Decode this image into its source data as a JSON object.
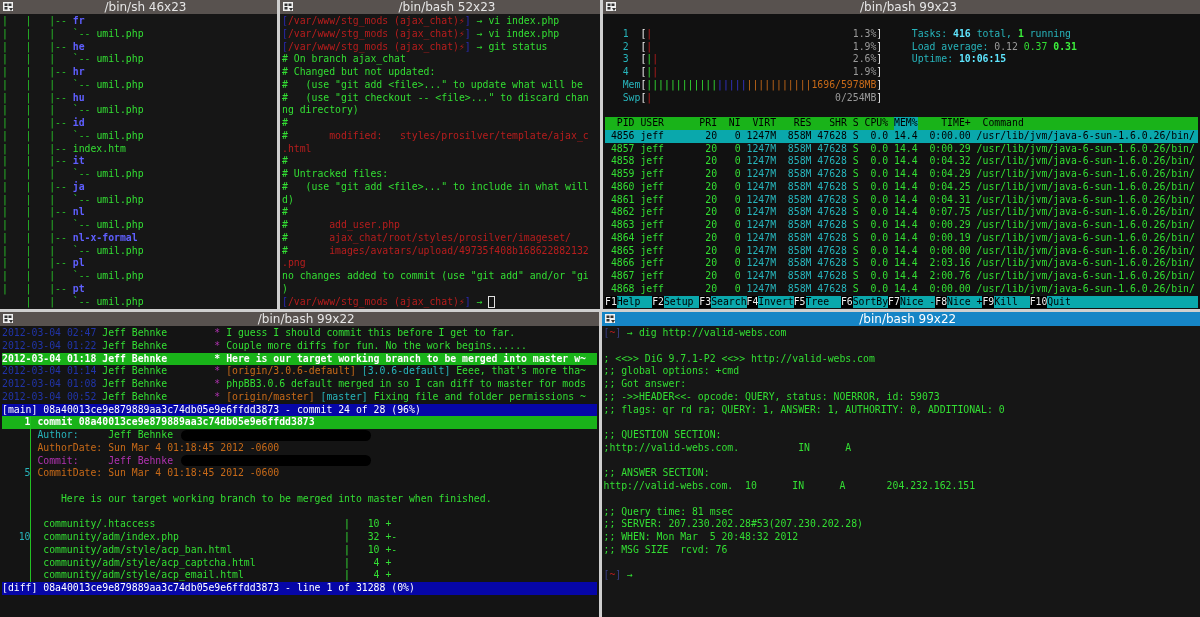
{
  "rows": [
    {
      "panes": [
        {
          "title": "/bin/sh 46x23",
          "active": false,
          "kind": "shell",
          "lines": [
            {
              "spans": [
                {
                  "text": "|   |   |-- ",
                  "kind": "pipe"
                },
                {
                  "text": "fr",
                  "kind": "dir"
                }
              ]
            },
            {
              "spans": [
                {
                  "text": "|   |   |   `-- ",
                  "kind": "pipe"
                },
                {
                  "text": "umil.php",
                  "kind": "g"
                }
              ]
            },
            {
              "spans": [
                {
                  "text": "|   |   |-- ",
                  "kind": "pipe"
                },
                {
                  "text": "he",
                  "kind": "dir"
                }
              ]
            },
            {
              "spans": [
                {
                  "text": "|   |   |   `-- ",
                  "kind": "pipe"
                },
                {
                  "text": "umil.php",
                  "kind": "g"
                }
              ]
            },
            {
              "spans": [
                {
                  "text": "|   |   |-- ",
                  "kind": "pipe"
                },
                {
                  "text": "hr",
                  "kind": "dir"
                }
              ]
            },
            {
              "spans": [
                {
                  "text": "|   |   |   `-- ",
                  "kind": "pipe"
                },
                {
                  "text": "umil.php",
                  "kind": "g"
                }
              ]
            },
            {
              "spans": [
                {
                  "text": "|   |   |-- ",
                  "kind": "pipe"
                },
                {
                  "text": "hu",
                  "kind": "dir"
                }
              ]
            },
            {
              "spans": [
                {
                  "text": "|   |   |   `-- ",
                  "kind": "pipe"
                },
                {
                  "text": "umil.php",
                  "kind": "g"
                }
              ]
            },
            {
              "spans": [
                {
                  "text": "|   |   |-- ",
                  "kind": "pipe"
                },
                {
                  "text": "id",
                  "kind": "dir"
                }
              ]
            },
            {
              "spans": [
                {
                  "text": "|   |   |   `-- ",
                  "kind": "pipe"
                },
                {
                  "text": "umil.php",
                  "kind": "g"
                }
              ]
            },
            {
              "spans": [
                {
                  "text": "|   |   |-- ",
                  "kind": "pipe"
                },
                {
                  "text": "index.htm",
                  "kind": "g"
                }
              ]
            },
            {
              "spans": [
                {
                  "text": "|   |   |-- ",
                  "kind": "pipe"
                },
                {
                  "text": "it",
                  "kind": "dir"
                }
              ]
            },
            {
              "spans": [
                {
                  "text": "|   |   |   `-- ",
                  "kind": "pipe"
                },
                {
                  "text": "umil.php",
                  "kind": "g"
                }
              ]
            },
            {
              "spans": [
                {
                  "text": "|   |   |-- ",
                  "kind": "pipe"
                },
                {
                  "text": "ja",
                  "kind": "dir"
                }
              ]
            },
            {
              "spans": [
                {
                  "text": "|   |   |   `-- ",
                  "kind": "pipe"
                },
                {
                  "text": "umil.php",
                  "kind": "g"
                }
              ]
            },
            {
              "spans": [
                {
                  "text": "|   |   |-- ",
                  "kind": "pipe"
                },
                {
                  "text": "nl",
                  "kind": "dir"
                }
              ]
            },
            {
              "spans": [
                {
                  "text": "|   |   |   `-- ",
                  "kind": "pipe"
                },
                {
                  "text": "umil.php",
                  "kind": "g"
                }
              ]
            },
            {
              "spans": [
                {
                  "text": "|   |   |-- ",
                  "kind": "pipe"
                },
                {
                  "text": "nl-x-formal",
                  "kind": "dir"
                }
              ]
            },
            {
              "spans": [
                {
                  "text": "|   |   |   `-- ",
                  "kind": "pipe"
                },
                {
                  "text": "umil.php",
                  "kind": "g"
                }
              ]
            },
            {
              "spans": [
                {
                  "text": "|   |   |-- ",
                  "kind": "pipe"
                },
                {
                  "text": "pl",
                  "kind": "dir"
                }
              ]
            },
            {
              "spans": [
                {
                  "text": "|   |   |   `-- ",
                  "kind": "pipe"
                },
                {
                  "text": "umil.php",
                  "kind": "g"
                }
              ]
            },
            {
              "spans": [
                {
                  "text": "|   |   |-- ",
                  "kind": "pipe"
                },
                {
                  "text": "pt",
                  "kind": "dir"
                }
              ]
            },
            {
              "spans": [
                {
                  "text": "    |   |   `-- ",
                  "kind": "pipe"
                },
                {
                  "text": "umil.php",
                  "kind": "g"
                }
              ]
            }
          ]
        },
        {
          "title": "/bin/bash 52x23",
          "active": false,
          "kind": "shell",
          "lines": [
            {
              "spans": [
                {
                  "text": "[",
                  "kind": "bracket"
                },
                {
                  "text": "/var/www/stg_mods (ajax_chat)⚡",
                  "kind": "red"
                },
                {
                  "text": "]",
                  "kind": "bracket"
                },
                {
                  "text": " → vi index.php",
                  "kind": "g"
                }
              ]
            },
            {
              "spans": [
                {
                  "text": "[",
                  "kind": "bracket"
                },
                {
                  "text": "/var/www/stg_mods (ajax_chat)⚡",
                  "kind": "red"
                },
                {
                  "text": "]",
                  "kind": "bracket"
                },
                {
                  "text": " → vi index.php",
                  "kind": "g"
                }
              ]
            },
            {
              "spans": [
                {
                  "text": "[",
                  "kind": "bracket"
                },
                {
                  "text": "/var/www/stg_mods (ajax_chat)⚡",
                  "kind": "red"
                },
                {
                  "text": "]",
                  "kind": "bracket"
                },
                {
                  "text": " → git status",
                  "kind": "g"
                }
              ]
            },
            {
              "spans": [
                {
                  "text": "# On branch ajax_chat",
                  "kind": "g"
                }
              ]
            },
            {
              "spans": [
                {
                  "text": "# Changed but not updated:",
                  "kind": "g"
                }
              ]
            },
            {
              "spans": [
                {
                  "text": "#   (use \"git add <file>...\" to update what will be",
                  "kind": "g"
                }
              ]
            },
            {
              "spans": [
                {
                  "text": "#   (use \"git checkout -- <file>...\" to discard chan",
                  "kind": "g"
                }
              ]
            },
            {
              "spans": [
                {
                  "text": "ng directory)",
                  "kind": "g"
                }
              ]
            },
            {
              "spans": [
                {
                  "text": "#",
                  "kind": "g"
                }
              ]
            },
            {
              "spans": [
                {
                  "text": "#",
                  "kind": "g"
                },
                {
                  "text": "       modified:   styles/prosilver/template/ajax_c",
                  "kind": "red"
                }
              ]
            },
            {
              "spans": [
                {
                  "text": ".html",
                  "kind": "red"
                }
              ]
            },
            {
              "spans": [
                {
                  "text": "#",
                  "kind": "g"
                }
              ]
            },
            {
              "spans": [
                {
                  "text": "# Untracked files:",
                  "kind": "g"
                }
              ]
            },
            {
              "spans": [
                {
                  "text": "#   (use \"git add <file>...\" to include in what will",
                  "kind": "g"
                }
              ]
            },
            {
              "spans": [
                {
                  "text": "d)",
                  "kind": "g"
                }
              ]
            },
            {
              "spans": [
                {
                  "text": "#",
                  "kind": "g"
                }
              ]
            },
            {
              "spans": [
                {
                  "text": "#",
                  "kind": "g"
                },
                {
                  "text": "       add_user.php",
                  "kind": "red"
                }
              ]
            },
            {
              "spans": [
                {
                  "text": "#",
                  "kind": "g"
                },
                {
                  "text": "       ajax_chat/root/styles/prosilver/imageset/",
                  "kind": "red"
                }
              ]
            },
            {
              "spans": [
                {
                  "text": "#",
                  "kind": "g"
                },
                {
                  "text": "       images/avatars/upload/49735f408b168622882132",
                  "kind": "red"
                }
              ]
            },
            {
              "spans": [
                {
                  "text": ".png",
                  "kind": "red"
                }
              ]
            },
            {
              "spans": [
                {
                  "text": "no changes added to commit (use \"git add\" and/or \"gi",
                  "kind": "g"
                }
              ]
            },
            {
              "spans": [
                {
                  "text": ")",
                  "kind": "g"
                }
              ]
            },
            {
              "cursor": true,
              "spans": [
                {
                  "text": "[",
                  "kind": "bracket"
                },
                {
                  "text": "/var/www/stg_mods (ajax_chat)⚡",
                  "kind": "red"
                },
                {
                  "text": "]",
                  "kind": "bracket"
                },
                {
                  "text": " → ",
                  "kind": "g"
                }
              ]
            }
          ]
        },
        {
          "title": "/bin/bash 99x23",
          "active": false,
          "kind": "htop",
          "lines": [
            {
              "kind": "blank"
            },
            {
              "spans": [
                {
                  "text": "   1  ",
                  "kind": "cyan"
                },
                {
                  "text": "[",
                  "kind": "white"
                },
                {
                  "text": "|",
                  "kind": "red"
                },
                {
                  "text": "                                  1.3%",
                  "kind": "grey"
                },
                {
                  "text": "]",
                  "kind": "white"
                },
                {
                  "text": "     Tasks: ",
                  "kind": "cyan"
                },
                {
                  "text": "416",
                  "kind": "cyanb"
                },
                {
                  "text": " total, ",
                  "kind": "cyan"
                },
                {
                  "text": "1",
                  "kind": "gb"
                },
                {
                  "text": " running",
                  "kind": "cyan"
                }
              ]
            },
            {
              "spans": [
                {
                  "text": "   2  ",
                  "kind": "cyan"
                },
                {
                  "text": "[",
                  "kind": "white"
                },
                {
                  "text": "|",
                  "kind": "red"
                },
                {
                  "text": "                                  1.9%",
                  "kind": "grey"
                },
                {
                  "text": "]",
                  "kind": "white"
                },
                {
                  "text": "     Load average: ",
                  "kind": "cyan"
                },
                {
                  "text": "0.12 ",
                  "kind": "grey"
                },
                {
                  "text": "0.37 ",
                  "kind": "g"
                },
                {
                  "text": "0.31",
                  "kind": "gb"
                }
              ]
            },
            {
              "spans": [
                {
                  "text": "   3  ",
                  "kind": "cyan"
                },
                {
                  "text": "[",
                  "kind": "white"
                },
                {
                  "text": "|",
                  "kind": "g"
                },
                {
                  "text": "|",
                  "kind": "red"
                },
                {
                  "text": "                                 2.6%",
                  "kind": "grey"
                },
                {
                  "text": "]",
                  "kind": "white"
                },
                {
                  "text": "     Uptime: ",
                  "kind": "cyan"
                },
                {
                  "text": "10:06:15",
                  "kind": "cyanb"
                }
              ]
            },
            {
              "spans": [
                {
                  "text": "   4  ",
                  "kind": "cyan"
                },
                {
                  "text": "[",
                  "kind": "white"
                },
                {
                  "text": "|",
                  "kind": "g"
                },
                {
                  "text": "|",
                  "kind": "red"
                },
                {
                  "text": "                                 1.9%",
                  "kind": "grey"
                },
                {
                  "text": "]",
                  "kind": "white"
                }
              ]
            },
            {
              "spans": [
                {
                  "text": "   Mem",
                  "kind": "cyan"
                },
                {
                  "text": "[",
                  "kind": "white"
                },
                {
                  "text": "||||||||||||",
                  "kind": "g"
                },
                {
                  "text": "|||||",
                  "kind": "blue"
                },
                {
                  "text": "|||||||||||",
                  "kind": "orange"
                },
                {
                  "text": "1696/5978MB",
                  "kind": "orange"
                },
                {
                  "text": "]",
                  "kind": "white"
                }
              ]
            },
            {
              "spans": [
                {
                  "text": "   Swp",
                  "kind": "cyan"
                },
                {
                  "text": "[",
                  "kind": "white"
                },
                {
                  "text": "|",
                  "kind": "red"
                },
                {
                  "text": "                               0/254MB",
                  "kind": "grey"
                },
                {
                  "text": "]",
                  "kind": "white"
                }
              ]
            },
            {
              "kind": "blank"
            },
            {
              "kind": "header",
              "spans": [
                {
                  "text": "  PID USER      PRI  NI  VIRT   RES   SHR S CPU% ",
                  "kind": "g"
                },
                {
                  "text": "MEM%",
                  "kind": "sort"
                },
                {
                  "text": "    TIME+  Command",
                  "kind": "g"
                }
              ]
            },
            {
              "kind": "row",
              "selected": true,
              "spans": [
                {
                  "text": " 4856 jeff       20   0",
                  "kind": "g"
                },
                {
                  "text": " 1247M  858M 47628",
                  "kind": "cyan"
                },
                {
                  "text": " S  0.0 14.4  0:00.00 /usr/lib/jvm/java-6-sun-1.6.0.26/bin/",
                  "kind": "g"
                }
              ]
            },
            {
              "kind": "row",
              "selected": false,
              "spans": [
                {
                  "text": " 4857 jeff       20   0",
                  "kind": "g"
                },
                {
                  "text": " 1247M  858M 47628",
                  "kind": "cyan"
                },
                {
                  "text": " S  0.0 14.4  0:00.29 /usr/lib/jvm/java-6-sun-1.6.0.26/bin/",
                  "kind": "g"
                }
              ]
            },
            {
              "kind": "row",
              "selected": false,
              "spans": [
                {
                  "text": " 4858 jeff       20   0",
                  "kind": "g"
                },
                {
                  "text": " 1247M  858M 47628",
                  "kind": "cyan"
                },
                {
                  "text": " S  0.0 14.4  0:04.32 /usr/lib/jvm/java-6-sun-1.6.0.26/bin/",
                  "kind": "g"
                }
              ]
            },
            {
              "kind": "row",
              "selected": false,
              "spans": [
                {
                  "text": " 4859 jeff       20   0",
                  "kind": "g"
                },
                {
                  "text": " 1247M  858M 47628",
                  "kind": "cyan"
                },
                {
                  "text": " S  0.0 14.4  0:04.29 /usr/lib/jvm/java-6-sun-1.6.0.26/bin/",
                  "kind": "g"
                }
              ]
            },
            {
              "kind": "row",
              "selected": false,
              "spans": [
                {
                  "text": " 4860 jeff       20   0",
                  "kind": "g"
                },
                {
                  "text": " 1247M  858M 47628",
                  "kind": "cyan"
                },
                {
                  "text": " S  0.0 14.4  0:04.25 /usr/lib/jvm/java-6-sun-1.6.0.26/bin/",
                  "kind": "g"
                }
              ]
            },
            {
              "kind": "row",
              "selected": false,
              "spans": [
                {
                  "text": " 4861 jeff       20   0",
                  "kind": "g"
                },
                {
                  "text": " 1247M  858M 47628",
                  "kind": "cyan"
                },
                {
                  "text": " S  0.0 14.4  0:04.31 /usr/lib/jvm/java-6-sun-1.6.0.26/bin/",
                  "kind": "g"
                }
              ]
            },
            {
              "kind": "row",
              "selected": false,
              "spans": [
                {
                  "text": " 4862 jeff       20   0",
                  "kind": "g"
                },
                {
                  "text": " 1247M  858M 47628",
                  "kind": "cyan"
                },
                {
                  "text": " S  0.0 14.4  0:07.75 /usr/lib/jvm/java-6-sun-1.6.0.26/bin/",
                  "kind": "g"
                }
              ]
            },
            {
              "kind": "row",
              "selected": false,
              "spans": [
                {
                  "text": " 4863 jeff       20   0",
                  "kind": "g"
                },
                {
                  "text": " 1247M  858M 47628",
                  "kind": "cyan"
                },
                {
                  "text": " S  0.0 14.4  0:00.29 /usr/lib/jvm/java-6-sun-1.6.0.26/bin/",
                  "kind": "g"
                }
              ]
            },
            {
              "kind": "row",
              "selected": false,
              "spans": [
                {
                  "text": " 4864 jeff       20   0",
                  "kind": "g"
                },
                {
                  "text": " 1247M  858M 47628",
                  "kind": "cyan"
                },
                {
                  "text": " S  0.0 14.4  0:00.19 /usr/lib/jvm/java-6-sun-1.6.0.26/bin/",
                  "kind": "g"
                }
              ]
            },
            {
              "kind": "row",
              "selected": false,
              "spans": [
                {
                  "text": " 4865 jeff       20   0",
                  "kind": "g"
                },
                {
                  "text": " 1247M  858M 47628",
                  "kind": "cyan"
                },
                {
                  "text": " S  0.0 14.4  0:00.00 /usr/lib/jvm/java-6-sun-1.6.0.26/bin/",
                  "kind": "g"
                }
              ]
            },
            {
              "kind": "row",
              "selected": false,
              "spans": [
                {
                  "text": " 4866 jeff       20   0",
                  "kind": "g"
                },
                {
                  "text": " 1247M  858M 47628",
                  "kind": "cyan"
                },
                {
                  "text": " S  0.0 14.4  2:03.16 /usr/lib/jvm/java-6-sun-1.6.0.26/bin/",
                  "kind": "g"
                }
              ]
            },
            {
              "kind": "row",
              "selected": false,
              "spans": [
                {
                  "text": " 4867 jeff       20   0",
                  "kind": "g"
                },
                {
                  "text": " 1247M  858M 47628",
                  "kind": "cyan"
                },
                {
                  "text": " S  0.0 14.4  2:00.76 /usr/lib/jvm/java-6-sun-1.6.0.26/bin/",
                  "kind": "g"
                }
              ]
            },
            {
              "kind": "row",
              "selected": false,
              "spans": [
                {
                  "text": " 4868 jeff       20   0",
                  "kind": "g"
                },
                {
                  "text": " 1247M  858M 47628",
                  "kind": "cyan"
                },
                {
                  "text": " S  0.0 14.4  0:00.00 /usr/lib/jvm/java-6-sun-1.6.0.26/bin/",
                  "kind": "g"
                }
              ]
            },
            {
              "kind": "fkeys",
              "keys": [
                {
                  "key": "F1",
                  "label": "Help"
                },
                {
                  "key": "F2",
                  "label": "Setup"
                },
                {
                  "key": "F3",
                  "label": "Search"
                },
                {
                  "key": "F4",
                  "label": "Invert"
                },
                {
                  "key": "F5",
                  "label": "Tree"
                },
                {
                  "key": "F6",
                  "label": "SortBy"
                },
                {
                  "key": "F7",
                  "label": "Nice -"
                },
                {
                  "key": "F8",
                  "label": "Nice +"
                },
                {
                  "key": "F9",
                  "label": "Kill"
                },
                {
                  "key": "F10",
                  "label": "Quit"
                }
              ]
            }
          ]
        }
      ]
    },
    {
      "panes": [
        {
          "title": "/bin/bash 99x22",
          "active": false,
          "kind": "tig",
          "lines": [
            {
              "kind": "row",
              "selected": false,
              "spans": [
                {
                  "text": "2012-03-04 02:47 ",
                  "kind": "dblue"
                },
                {
                  "text": "Jeff Behnke        ",
                  "kind": "g"
                },
                {
                  "text": "* ",
                  "kind": "purple"
                },
                {
                  "text": "I guess I should commit this before I get to far.",
                  "kind": "g"
                }
              ]
            },
            {
              "kind": "row",
              "selected": false,
              "spans": [
                {
                  "text": "2012-03-04 01:22 ",
                  "kind": "dblue"
                },
                {
                  "text": "Jeff Behnke        ",
                  "kind": "g"
                },
                {
                  "text": "* ",
                  "kind": "purple"
                },
                {
                  "text": "Couple more diffs for fun. No the work begins......",
                  "kind": "g"
                }
              ]
            },
            {
              "kind": "row",
              "selected": true,
              "spans": [
                {
                  "text": "2012-03-04 01:18 ",
                  "kind": "dblue"
                },
                {
                  "text": "Jeff Behnke        ",
                  "kind": "g"
                },
                {
                  "text": "* ",
                  "kind": "purple"
                },
                {
                  "text": "Here is our target working branch to be merged into master w~",
                  "kind": "g"
                }
              ]
            },
            {
              "kind": "row",
              "selected": false,
              "spans": [
                {
                  "text": "2012-03-04 01:14 ",
                  "kind": "dblue"
                },
                {
                  "text": "Jeff Behnke        ",
                  "kind": "g"
                },
                {
                  "text": "* ",
                  "kind": "purple"
                },
                {
                  "text": "[origin/3.0.6-default]",
                  "kind": "orange"
                },
                {
                  "text": " [3.0.6-default]",
                  "kind": "cyan"
                },
                {
                  "text": " Eeee, that's more tha~",
                  "kind": "g"
                }
              ]
            },
            {
              "kind": "row",
              "selected": false,
              "spans": [
                {
                  "text": "2012-03-04 01:08 ",
                  "kind": "dblue"
                },
                {
                  "text": "Jeff Behnke        ",
                  "kind": "g"
                },
                {
                  "text": "* ",
                  "kind": "purple"
                },
                {
                  "text": "phpBB3.0.6 default merged in so I can diff to master for mods",
                  "kind": "g"
                }
              ]
            },
            {
              "kind": "row",
              "selected": false,
              "spans": [
                {
                  "text": "2012-03-04 00:52 ",
                  "kind": "dblue"
                },
                {
                  "text": "Jeff Behnke        ",
                  "kind": "g"
                },
                {
                  "text": "* ",
                  "kind": "purple"
                },
                {
                  "text": "[origin/master]",
                  "kind": "orange"
                },
                {
                  "text": " [master]",
                  "kind": "cyan"
                },
                {
                  "text": " Fixing file and folder permissions ~",
                  "kind": "g"
                }
              ]
            },
            {
              "kind": "status",
              "spans": [
                {
                  "text": "[main] 08a40013ce9e879889aa3c74db05e9e6ffdd3873 - commit 24 of 28 (96%)",
                  "kind": "white"
                }
              ]
            },
            {
              "kind": "cursor-line",
              "gutter": true,
              "lineno": "1",
              "spans": [
                {
                  "text": " commit 08a40013ce9e879889aa3c74db05e9e6ffdd3873",
                  "kind": "white"
                }
              ]
            },
            {
              "gutter": true,
              "redacted": true,
              "spans": [
                {
                  "text": " Author:     ",
                  "kind": "cyan"
                },
                {
                  "text": "Jeff Behnke",
                  "kind": "g"
                }
              ]
            },
            {
              "gutter": true,
              "spans": [
                {
                  "text": " AuthorDate: Sun Mar 4 01:18:45 2012 -0600",
                  "kind": "orange"
                }
              ]
            },
            {
              "gutter": true,
              "redacted": true,
              "spans": [
                {
                  "text": " Commit:     Jeff Behnke",
                  "kind": "purple"
                }
              ]
            },
            {
              "gutter": true,
              "lineno": "5",
              "spans": [
                {
                  "text": " CommitDate: Sun Mar 4 01:18:45 2012 -0600",
                  "kind": "orange"
                }
              ]
            },
            {
              "kind": "blank",
              "gutter": true
            },
            {
              "gutter": true,
              "spans": [
                {
                  "text": "     Here is our target working branch to be merged into master when finished.",
                  "kind": "g"
                }
              ]
            },
            {
              "kind": "blank",
              "gutter": true
            },
            {
              "gutter": true,
              "spans": [
                {
                  "text": "  community/.htaccess                                |   10 +",
                  "kind": "g"
                }
              ]
            },
            {
              "gutter": true,
              "lineno": "10",
              "spans": [
                {
                  "text": "  community/adm/index.php                            |   32 +-",
                  "kind": "g"
                }
              ]
            },
            {
              "gutter": true,
              "spans": [
                {
                  "text": "  community/adm/style/acp_ban.html                   |   10 +-",
                  "kind": "g"
                }
              ]
            },
            {
              "gutter": true,
              "spans": [
                {
                  "text": "  community/adm/style/acp_captcha.html               |    4 +",
                  "kind": "g"
                }
              ]
            },
            {
              "gutter": true,
              "spans": [
                {
                  "text": "  community/adm/style/acp_email.html                 |    4 +",
                  "kind": "g"
                }
              ]
            },
            {
              "kind": "status",
              "spans": [
                {
                  "text": "[diff] 08a40013ce9e879889aa3c74db05e9e6ffdd3873 - line 1 of 31288 (0%)",
                  "kind": "white"
                }
              ]
            }
          ]
        },
        {
          "title": "/bin/bash 99x22",
          "active": true,
          "kind": "shell",
          "lines": [
            {
              "spans": [
                {
                  "text": "[",
                  "kind": "dim"
                },
                {
                  "text": "~",
                  "kind": "red"
                },
                {
                  "text": "]",
                  "kind": "dim"
                },
                {
                  "text": " → dig http://valid-webs.com",
                  "kind": "g"
                }
              ]
            },
            {
              "kind": "blank"
            },
            {
              "spans": [
                {
                  "text": "; <<>> DiG 9.7.1-P2 <<>> http://valid-webs.com",
                  "kind": "g"
                }
              ]
            },
            {
              "spans": [
                {
                  "text": ";; global options: +cmd",
                  "kind": "g"
                }
              ]
            },
            {
              "spans": [
                {
                  "text": ";; Got answer:",
                  "kind": "g"
                }
              ]
            },
            {
              "spans": [
                {
                  "text": ";; ->>HEADER<<- opcode: QUERY, status: NOERROR, id: 59073",
                  "kind": "g"
                }
              ]
            },
            {
              "spans": [
                {
                  "text": ";; flags: qr rd ra; QUERY: 1, ANSWER: 1, AUTHORITY: 0, ADDITIONAL: 0",
                  "kind": "g"
                }
              ]
            },
            {
              "kind": "blank"
            },
            {
              "spans": [
                {
                  "text": ";; QUESTION SECTION:",
                  "kind": "g"
                }
              ]
            },
            {
              "spans": [
                {
                  "text": ";http://valid-webs.com.          IN      A",
                  "kind": "g"
                }
              ]
            },
            {
              "kind": "blank"
            },
            {
              "spans": [
                {
                  "text": ";; ANSWER SECTION:",
                  "kind": "g"
                }
              ]
            },
            {
              "spans": [
                {
                  "text": "http://valid-webs.com.  10      IN      A       204.232.162.151",
                  "kind": "g"
                }
              ]
            },
            {
              "kind": "blank"
            },
            {
              "spans": [
                {
                  "text": ";; Query time: 81 msec",
                  "kind": "g"
                }
              ]
            },
            {
              "spans": [
                {
                  "text": ";; SERVER: 207.230.202.28#53(207.230.202.28)",
                  "kind": "g"
                }
              ]
            },
            {
              "spans": [
                {
                  "text": ";; WHEN: Mon Mar  5 20:48:32 2012",
                  "kind": "g"
                }
              ]
            },
            {
              "spans": [
                {
                  "text": ";; MSG SIZE  rcvd: 76",
                  "kind": "g"
                }
              ]
            },
            {
              "kind": "blank"
            },
            {
              "spans": [
                {
                  "text": "[",
                  "kind": "dim"
                },
                {
                  "text": "~",
                  "kind": "red"
                },
                {
                  "text": "]",
                  "kind": "dim"
                },
                {
                  "text": " →",
                  "kind": "g"
                }
              ]
            }
          ]
        }
      ]
    }
  ]
}
